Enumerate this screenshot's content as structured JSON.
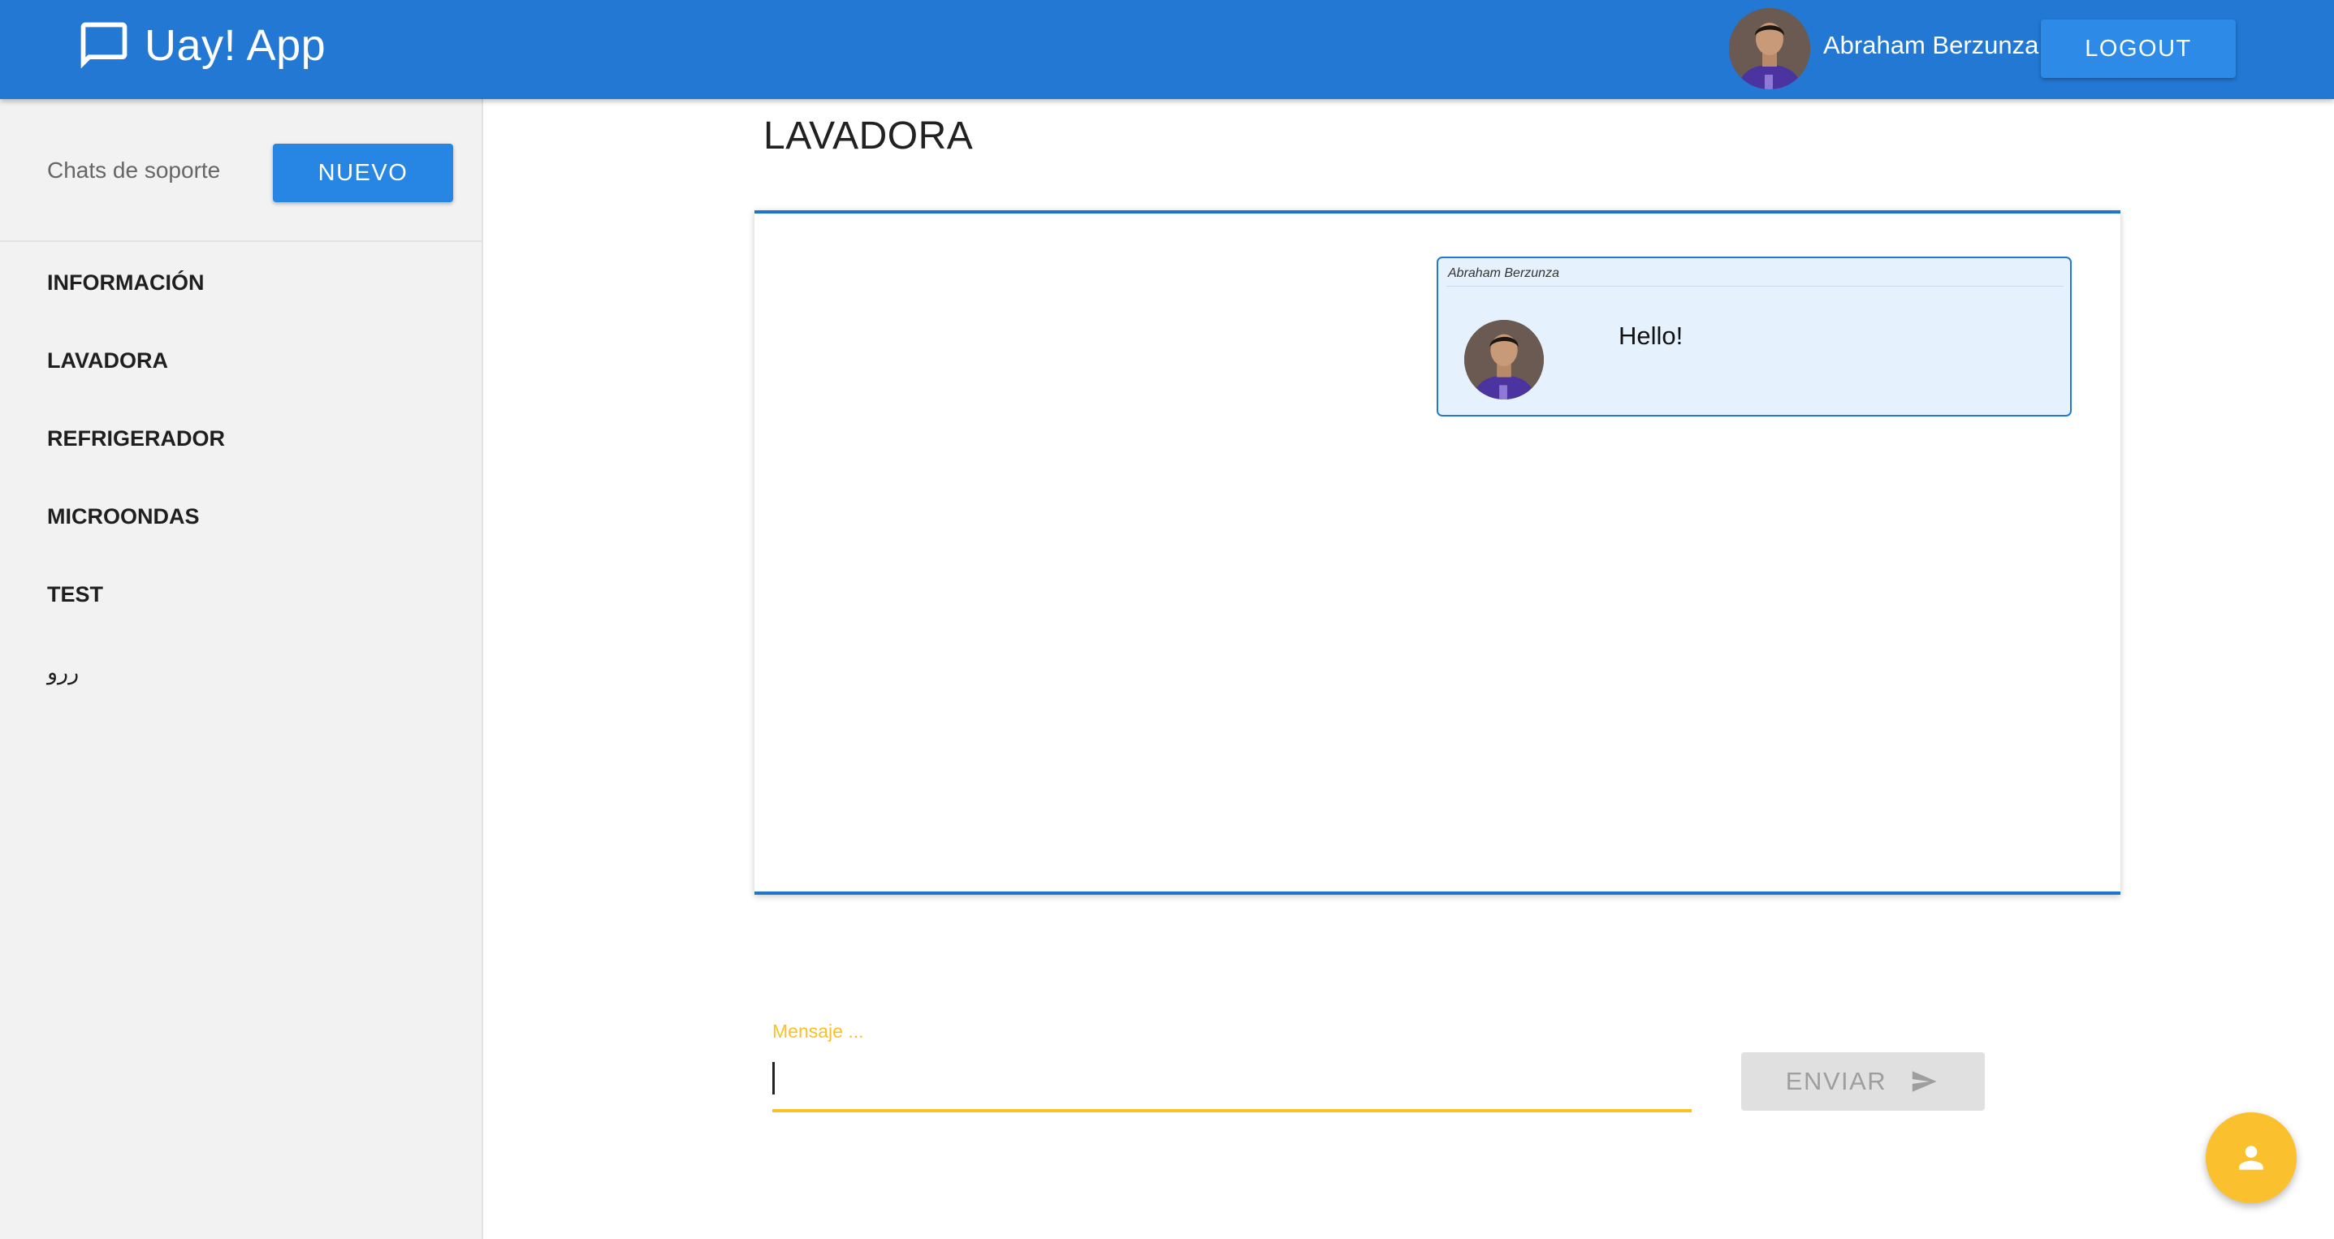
{
  "appbar": {
    "title": "Uay! App",
    "user_name": "Abraham Berzunza",
    "logout_label": "LOGOUT",
    "brand_icon": "chat-bubble-icon",
    "color": "#2378d3"
  },
  "sidebar": {
    "header_label": "Chats de soporte",
    "new_button_label": "NUEVO",
    "items": [
      {
        "label": "INFORMACIÓN"
      },
      {
        "label": "LAVADORA"
      },
      {
        "label": "REFRIGERADOR"
      },
      {
        "label": "MICROONDAS"
      },
      {
        "label": "TEST"
      },
      {
        "label": "ررو"
      }
    ]
  },
  "chat": {
    "title": "LAVADORA",
    "messages": [
      {
        "author": "Abraham Berzunza",
        "text": "Hello!"
      }
    ]
  },
  "composer": {
    "label": "Mensaje ...",
    "value": "",
    "send_label": "ENVIAR",
    "send_icon": "send-icon",
    "accent_color": "#f8c125"
  },
  "fab": {
    "icon": "person-icon",
    "color": "#fbc02d"
  }
}
